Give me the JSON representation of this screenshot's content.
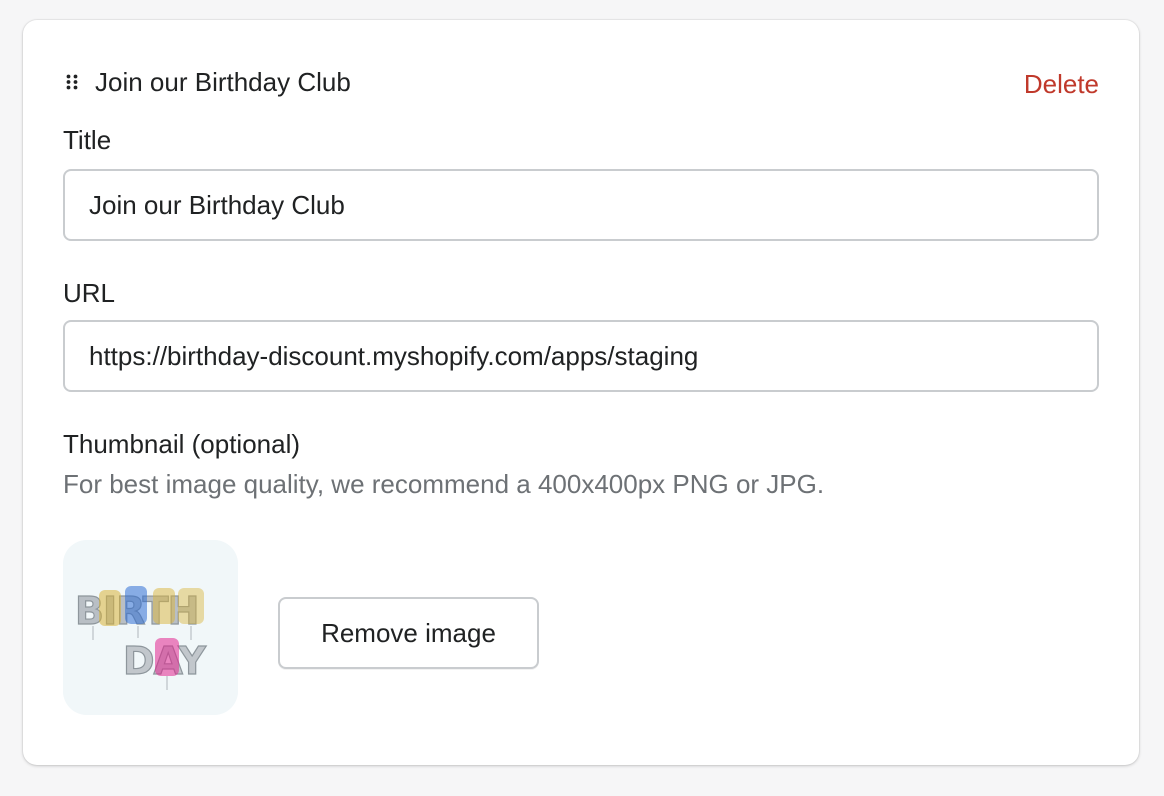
{
  "colors": {
    "accent_destructive": "#c0392b",
    "text_primary": "#202223",
    "text_subdued": "#6d7175",
    "border": "#c9cccf"
  },
  "header": {
    "icon": "drag-handle-icon",
    "title": "Join our Birthday Club",
    "delete_label": "Delete"
  },
  "fields": {
    "title": {
      "label": "Title",
      "value": "Join our Birthday Club"
    },
    "url": {
      "label": "URL",
      "value": "https://birthday-discount.myshopify.com/apps/staging"
    },
    "thumbnail": {
      "label": "Thumbnail (optional)",
      "help_text": "For best image quality, we recommend a 400x400px PNG or JPG.",
      "image_text": [
        "BIRTH",
        "DAY"
      ],
      "remove_label": "Remove image"
    }
  }
}
